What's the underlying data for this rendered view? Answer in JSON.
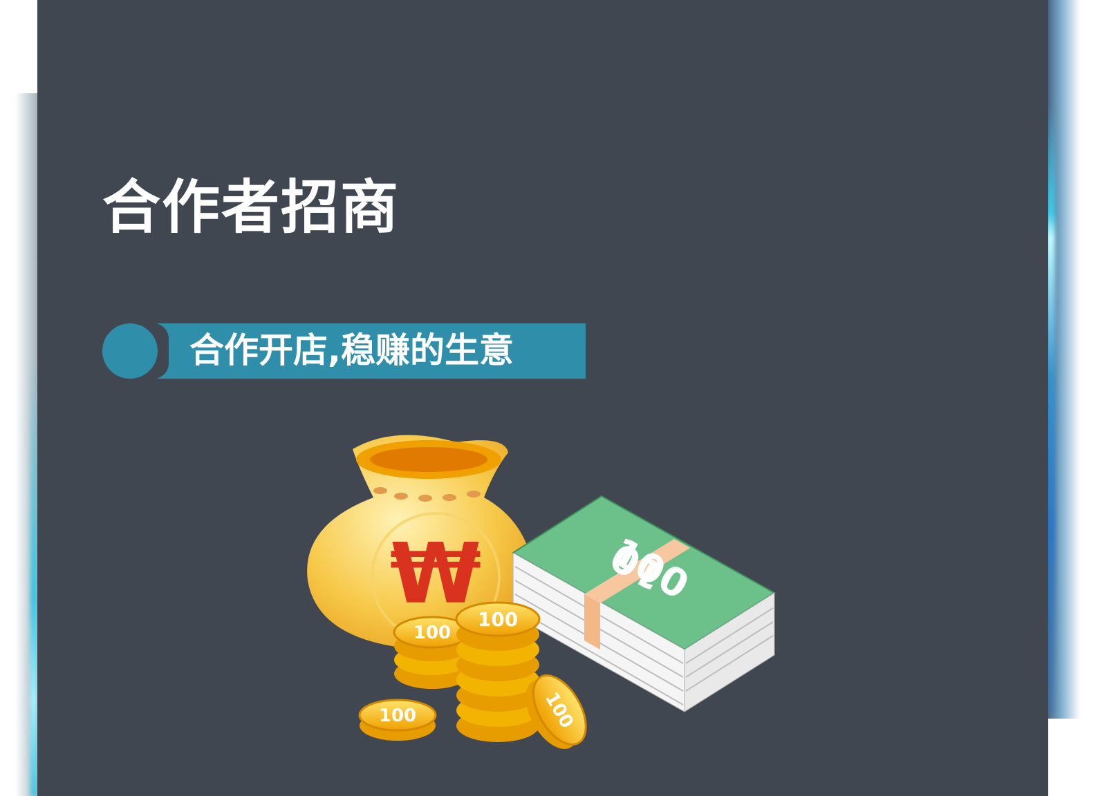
{
  "page": {
    "title": "合作者招商",
    "banner": "合作开店,稳赚的生意"
  },
  "illustration": {
    "bag_symbol": "₩",
    "coin_label": "100",
    "bill_label": "100",
    "bill_label_flipped": "10"
  },
  "colors": {
    "panel": "#414751",
    "accent": "#2f8fab",
    "gold": "#f4b81c",
    "bill_green": "#6cc18a",
    "won_red": "#d9321f"
  }
}
